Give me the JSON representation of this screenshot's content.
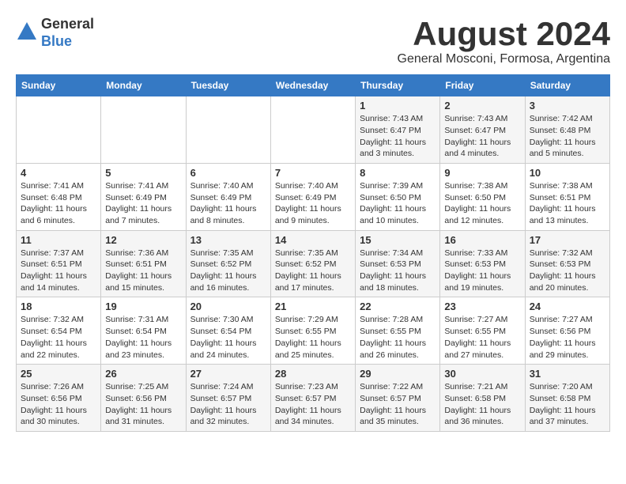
{
  "logo": {
    "general": "General",
    "blue": "Blue"
  },
  "title": "August 2024",
  "subtitle": "General Mosconi, Formosa, Argentina",
  "days_header": [
    "Sunday",
    "Monday",
    "Tuesday",
    "Wednesday",
    "Thursday",
    "Friday",
    "Saturday"
  ],
  "weeks": [
    [
      {
        "day": "",
        "info": ""
      },
      {
        "day": "",
        "info": ""
      },
      {
        "day": "",
        "info": ""
      },
      {
        "day": "",
        "info": ""
      },
      {
        "day": "1",
        "info": "Sunrise: 7:43 AM\nSunset: 6:47 PM\nDaylight: 11 hours\nand 3 minutes."
      },
      {
        "day": "2",
        "info": "Sunrise: 7:43 AM\nSunset: 6:47 PM\nDaylight: 11 hours\nand 4 minutes."
      },
      {
        "day": "3",
        "info": "Sunrise: 7:42 AM\nSunset: 6:48 PM\nDaylight: 11 hours\nand 5 minutes."
      }
    ],
    [
      {
        "day": "4",
        "info": "Sunrise: 7:41 AM\nSunset: 6:48 PM\nDaylight: 11 hours\nand 6 minutes."
      },
      {
        "day": "5",
        "info": "Sunrise: 7:41 AM\nSunset: 6:49 PM\nDaylight: 11 hours\nand 7 minutes."
      },
      {
        "day": "6",
        "info": "Sunrise: 7:40 AM\nSunset: 6:49 PM\nDaylight: 11 hours\nand 8 minutes."
      },
      {
        "day": "7",
        "info": "Sunrise: 7:40 AM\nSunset: 6:49 PM\nDaylight: 11 hours\nand 9 minutes."
      },
      {
        "day": "8",
        "info": "Sunrise: 7:39 AM\nSunset: 6:50 PM\nDaylight: 11 hours\nand 10 minutes."
      },
      {
        "day": "9",
        "info": "Sunrise: 7:38 AM\nSunset: 6:50 PM\nDaylight: 11 hours\nand 12 minutes."
      },
      {
        "day": "10",
        "info": "Sunrise: 7:38 AM\nSunset: 6:51 PM\nDaylight: 11 hours\nand 13 minutes."
      }
    ],
    [
      {
        "day": "11",
        "info": "Sunrise: 7:37 AM\nSunset: 6:51 PM\nDaylight: 11 hours\nand 14 minutes."
      },
      {
        "day": "12",
        "info": "Sunrise: 7:36 AM\nSunset: 6:51 PM\nDaylight: 11 hours\nand 15 minutes."
      },
      {
        "day": "13",
        "info": "Sunrise: 7:35 AM\nSunset: 6:52 PM\nDaylight: 11 hours\nand 16 minutes."
      },
      {
        "day": "14",
        "info": "Sunrise: 7:35 AM\nSunset: 6:52 PM\nDaylight: 11 hours\nand 17 minutes."
      },
      {
        "day": "15",
        "info": "Sunrise: 7:34 AM\nSunset: 6:53 PM\nDaylight: 11 hours\nand 18 minutes."
      },
      {
        "day": "16",
        "info": "Sunrise: 7:33 AM\nSunset: 6:53 PM\nDaylight: 11 hours\nand 19 minutes."
      },
      {
        "day": "17",
        "info": "Sunrise: 7:32 AM\nSunset: 6:53 PM\nDaylight: 11 hours\nand 20 minutes."
      }
    ],
    [
      {
        "day": "18",
        "info": "Sunrise: 7:32 AM\nSunset: 6:54 PM\nDaylight: 11 hours\nand 22 minutes."
      },
      {
        "day": "19",
        "info": "Sunrise: 7:31 AM\nSunset: 6:54 PM\nDaylight: 11 hours\nand 23 minutes."
      },
      {
        "day": "20",
        "info": "Sunrise: 7:30 AM\nSunset: 6:54 PM\nDaylight: 11 hours\nand 24 minutes."
      },
      {
        "day": "21",
        "info": "Sunrise: 7:29 AM\nSunset: 6:55 PM\nDaylight: 11 hours\nand 25 minutes."
      },
      {
        "day": "22",
        "info": "Sunrise: 7:28 AM\nSunset: 6:55 PM\nDaylight: 11 hours\nand 26 minutes."
      },
      {
        "day": "23",
        "info": "Sunrise: 7:27 AM\nSunset: 6:55 PM\nDaylight: 11 hours\nand 27 minutes."
      },
      {
        "day": "24",
        "info": "Sunrise: 7:27 AM\nSunset: 6:56 PM\nDaylight: 11 hours\nand 29 minutes."
      }
    ],
    [
      {
        "day": "25",
        "info": "Sunrise: 7:26 AM\nSunset: 6:56 PM\nDaylight: 11 hours\nand 30 minutes."
      },
      {
        "day": "26",
        "info": "Sunrise: 7:25 AM\nSunset: 6:56 PM\nDaylight: 11 hours\nand 31 minutes."
      },
      {
        "day": "27",
        "info": "Sunrise: 7:24 AM\nSunset: 6:57 PM\nDaylight: 11 hours\nand 32 minutes."
      },
      {
        "day": "28",
        "info": "Sunrise: 7:23 AM\nSunset: 6:57 PM\nDaylight: 11 hours\nand 34 minutes."
      },
      {
        "day": "29",
        "info": "Sunrise: 7:22 AM\nSunset: 6:57 PM\nDaylight: 11 hours\nand 35 minutes."
      },
      {
        "day": "30",
        "info": "Sunrise: 7:21 AM\nSunset: 6:58 PM\nDaylight: 11 hours\nand 36 minutes."
      },
      {
        "day": "31",
        "info": "Sunrise: 7:20 AM\nSunset: 6:58 PM\nDaylight: 11 hours\nand 37 minutes."
      }
    ]
  ]
}
